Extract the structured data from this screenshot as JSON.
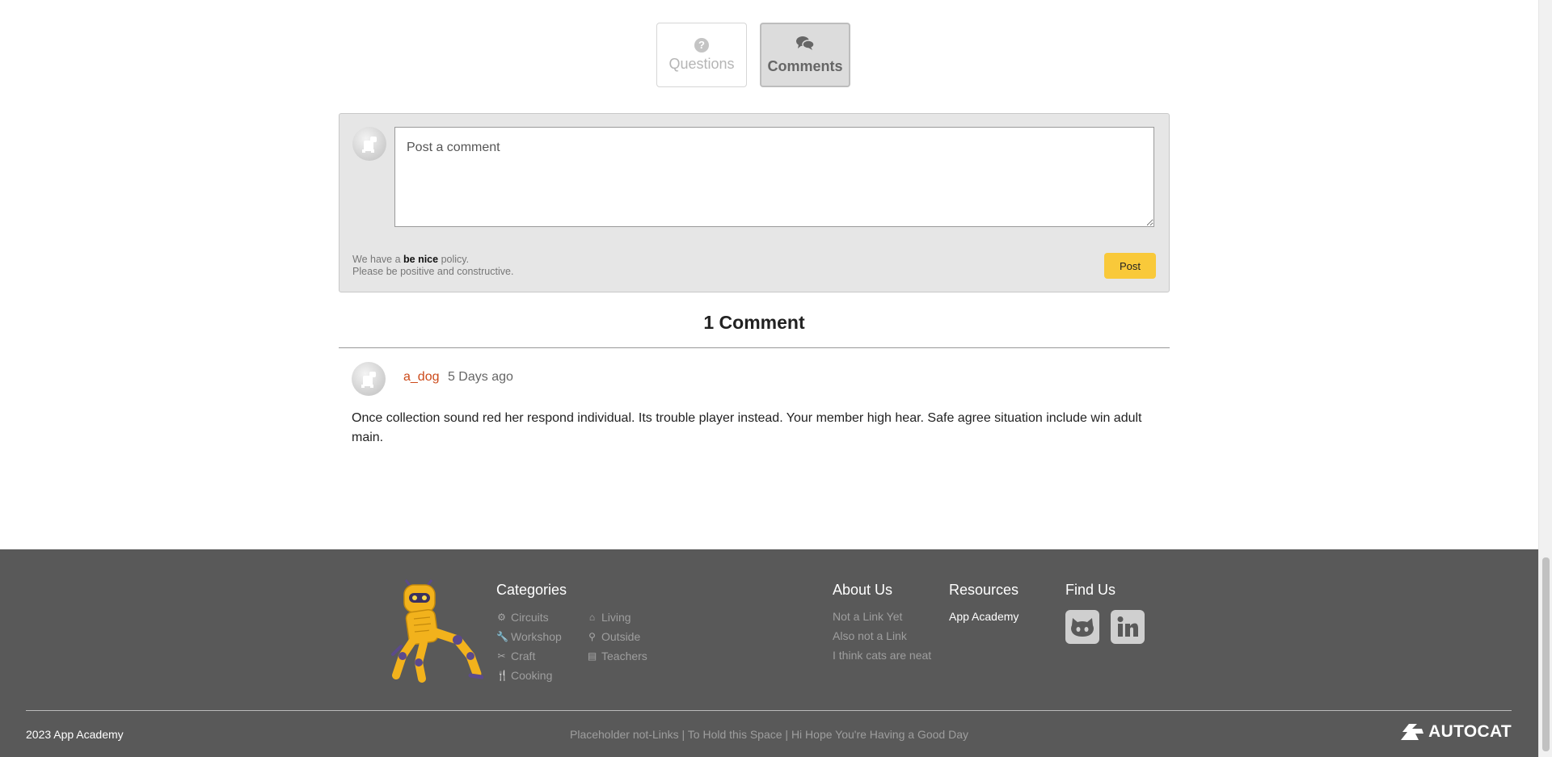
{
  "tabs": [
    {
      "label": "Questions",
      "icon": "question-circle-icon",
      "active": false
    },
    {
      "label": "Comments",
      "icon": "comments-icon",
      "active": true
    }
  ],
  "comment_form": {
    "placeholder": "Post a comment",
    "policy_prefix": "We have a ",
    "policy_bold": "be nice",
    "policy_suffix": " policy.",
    "policy_line2": "Please be positive and constructive.",
    "post_label": "Post",
    "post_color": "#f9c93a"
  },
  "comments": {
    "count_label": "1 Comment",
    "items": [
      {
        "author": "a_dog",
        "time": "5 Days ago",
        "text": "Once collection sound red her respond individual. Its trouble player instead. Your member high hear. Safe agree situation include win adult main."
      }
    ]
  },
  "footer": {
    "background": "#595959",
    "categories": {
      "heading": "Categories",
      "items": [
        {
          "label": "Circuits",
          "icon": "circuit-icon"
        },
        {
          "label": "Living",
          "icon": "home-icon"
        },
        {
          "label": "Workshop",
          "icon": "wrench-icon"
        },
        {
          "label": "Outside",
          "icon": "bicycle-icon"
        },
        {
          "label": "Craft",
          "icon": "scissors-icon"
        },
        {
          "label": "Teachers",
          "icon": "book-icon"
        },
        {
          "label": "Cooking",
          "icon": "utensils-icon"
        }
      ]
    },
    "about": {
      "heading": "About Us",
      "items": [
        "Not a Link Yet",
        "Also not a Link",
        "I think cats are neat"
      ]
    },
    "resources": {
      "heading": "Resources",
      "items": [
        "App Academy"
      ]
    },
    "find_us": {
      "heading": "Find Us",
      "icons": [
        "github-icon",
        "linkedin-icon"
      ]
    },
    "copyright": "2023 App Academy",
    "placeholder_links": "Placeholder not-Links | To Hold this Space | Hi Hope You're Having a Good Day",
    "brand": "AUTOCAT"
  }
}
